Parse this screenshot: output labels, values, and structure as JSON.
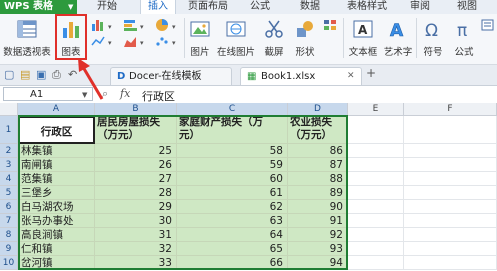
{
  "menubar": {
    "app_label": "WPS 表格",
    "tabs": [
      "开始",
      "插入",
      "页面布局",
      "公式",
      "数据",
      "表格样式",
      "审阅",
      "视图"
    ],
    "active_tab": "插入"
  },
  "ribbon": {
    "pivot_label": "数据透视表",
    "chart_label": "图表",
    "picture_label": "图片",
    "online_picture_label": "在线图片",
    "screenshot_label": "截屏",
    "shape_label": "形状",
    "textbox_label": "文本框",
    "wordart_label": "艺术字",
    "symbol_label": "符号",
    "formula_label": "公式"
  },
  "doc_tabs": [
    {
      "label": "Docer-在线模板"
    },
    {
      "label": "Book1.xlsx"
    }
  ],
  "formula_bar": {
    "cell_ref": "A1",
    "fx_label": "fx",
    "content": "行政区"
  },
  "sheet": {
    "columns": [
      "A",
      "B",
      "C",
      "D",
      "E",
      "F"
    ],
    "row_numbers": [
      "1",
      "2",
      "3",
      "4",
      "5",
      "6",
      "7",
      "8",
      "9",
      "10"
    ],
    "header": {
      "a": "行政区",
      "b_line1": "居民房屋损失",
      "b_line2": "（万元）",
      "c_line1": "家庭财产损失（万",
      "c_line2": "元）",
      "d_line1": "农业损失",
      "d_line2": "（万元）"
    },
    "rows": [
      {
        "name": "林集镇",
        "b": "25",
        "c": "58",
        "d": "86"
      },
      {
        "name": "南闸镇",
        "b": "26",
        "c": "59",
        "d": "87"
      },
      {
        "name": "范集镇",
        "b": "27",
        "c": "60",
        "d": "88"
      },
      {
        "name": "三堡乡",
        "b": "28",
        "c": "61",
        "d": "89"
      },
      {
        "name": "白马湖农场",
        "b": "29",
        "c": "62",
        "d": "90"
      },
      {
        "name": "张马办事处",
        "b": "30",
        "c": "63",
        "d": "91"
      },
      {
        "name": "高良涧镇",
        "b": "31",
        "c": "64",
        "d": "92"
      },
      {
        "name": "仁和镇",
        "b": "32",
        "c": "65",
        "d": "93"
      },
      {
        "name": "岔河镇",
        "b": "33",
        "c": "66",
        "d": "94"
      }
    ]
  },
  "colors": {
    "wps_green": "#2d9a3d",
    "data_fill": "#cfe8c4",
    "selection_border": "#1f7d33",
    "highlight_red": "#e0302a"
  }
}
